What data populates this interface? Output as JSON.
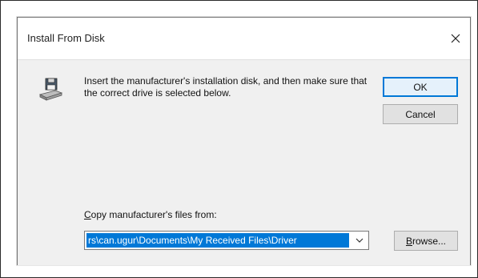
{
  "dialog": {
    "title": "Install From Disk",
    "instruction": "Insert the manufacturer's installation disk, and then make sure that the correct drive is selected below.",
    "ok_label": "OK",
    "cancel_label": "Cancel",
    "copy_label_accel": "C",
    "copy_label_rest": "opy manufacturer's files from:",
    "path_value": "rs\\can.ugur\\Documents\\My Received Files\\Driver",
    "browse_label_accel": "B",
    "browse_label_rest": "rowse...",
    "icons": {
      "close": "close-icon",
      "disk": "floppy-drive-icon",
      "dropdown": "chevron-down-icon"
    },
    "colors": {
      "accent": "#0078d7",
      "body_background": "#f0f0f0"
    }
  }
}
